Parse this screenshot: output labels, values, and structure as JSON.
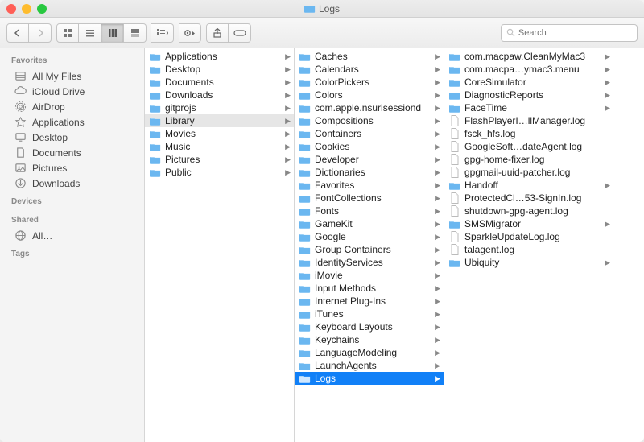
{
  "title": "Logs",
  "search": {
    "placeholder": "Search"
  },
  "sidebar": {
    "sections": [
      {
        "label": "Favorites",
        "items": [
          {
            "label": "All My Files",
            "icon": "all-my-files-icon"
          },
          {
            "label": "iCloud Drive",
            "icon": "icloud-icon"
          },
          {
            "label": "AirDrop",
            "icon": "airdrop-icon"
          },
          {
            "label": "Applications",
            "icon": "applications-icon"
          },
          {
            "label": "Desktop",
            "icon": "desktop-icon"
          },
          {
            "label": "Documents",
            "icon": "documents-icon"
          },
          {
            "label": "Pictures",
            "icon": "pictures-icon"
          },
          {
            "label": "Downloads",
            "icon": "downloads-icon"
          }
        ]
      },
      {
        "label": "Devices",
        "items": []
      },
      {
        "label": "Shared",
        "items": [
          {
            "label": "All…",
            "icon": "globe-icon"
          }
        ]
      },
      {
        "label": "Tags",
        "items": []
      }
    ]
  },
  "columns": [
    {
      "items": [
        {
          "label": "Applications",
          "type": "folder",
          "hasChildren": true
        },
        {
          "label": "Desktop",
          "type": "folder",
          "hasChildren": true
        },
        {
          "label": "Documents",
          "type": "folder",
          "hasChildren": true
        },
        {
          "label": "Downloads",
          "type": "folder",
          "hasChildren": true
        },
        {
          "label": "gitprojs",
          "type": "folder",
          "hasChildren": true
        },
        {
          "label": "Library",
          "type": "folder",
          "hasChildren": true,
          "selected": "gray"
        },
        {
          "label": "Movies",
          "type": "folder",
          "hasChildren": true
        },
        {
          "label": "Music",
          "type": "folder",
          "hasChildren": true
        },
        {
          "label": "Pictures",
          "type": "folder",
          "hasChildren": true
        },
        {
          "label": "Public",
          "type": "folder",
          "hasChildren": true
        }
      ]
    },
    {
      "items": [
        {
          "label": "Caches",
          "type": "folder",
          "hasChildren": true
        },
        {
          "label": "Calendars",
          "type": "folder",
          "hasChildren": true
        },
        {
          "label": "ColorPickers",
          "type": "folder",
          "hasChildren": true
        },
        {
          "label": "Colors",
          "type": "folder",
          "hasChildren": true
        },
        {
          "label": "com.apple.nsurlsessiond",
          "type": "folder",
          "hasChildren": true
        },
        {
          "label": "Compositions",
          "type": "folder",
          "hasChildren": true
        },
        {
          "label": "Containers",
          "type": "folder",
          "hasChildren": true
        },
        {
          "label": "Cookies",
          "type": "folder",
          "hasChildren": true
        },
        {
          "label": "Developer",
          "type": "folder",
          "hasChildren": true
        },
        {
          "label": "Dictionaries",
          "type": "folder",
          "hasChildren": true
        },
        {
          "label": "Favorites",
          "type": "folder",
          "hasChildren": true
        },
        {
          "label": "FontCollections",
          "type": "folder",
          "hasChildren": true
        },
        {
          "label": "Fonts",
          "type": "folder",
          "hasChildren": true
        },
        {
          "label": "GameKit",
          "type": "folder",
          "hasChildren": true
        },
        {
          "label": "Google",
          "type": "folder",
          "hasChildren": true
        },
        {
          "label": "Group Containers",
          "type": "folder",
          "hasChildren": true
        },
        {
          "label": "IdentityServices",
          "type": "folder",
          "hasChildren": true
        },
        {
          "label": "iMovie",
          "type": "folder",
          "hasChildren": true
        },
        {
          "label": "Input Methods",
          "type": "folder",
          "hasChildren": true
        },
        {
          "label": "Internet Plug-Ins",
          "type": "folder",
          "hasChildren": true
        },
        {
          "label": "iTunes",
          "type": "folder",
          "hasChildren": true
        },
        {
          "label": "Keyboard Layouts",
          "type": "folder",
          "hasChildren": true
        },
        {
          "label": "Keychains",
          "type": "folder",
          "hasChildren": true
        },
        {
          "label": "LanguageModeling",
          "type": "folder",
          "hasChildren": true
        },
        {
          "label": "LaunchAgents",
          "type": "folder",
          "hasChildren": true
        },
        {
          "label": "Logs",
          "type": "folder",
          "hasChildren": true,
          "selected": "blue"
        }
      ]
    },
    {
      "items": [
        {
          "label": "com.macpaw.CleanMyMac3",
          "type": "folder",
          "hasChildren": true
        },
        {
          "label": "com.macpa…ymac3.menu",
          "type": "folder",
          "hasChildren": true
        },
        {
          "label": "CoreSimulator",
          "type": "folder",
          "hasChildren": true
        },
        {
          "label": "DiagnosticReports",
          "type": "folder",
          "hasChildren": true
        },
        {
          "label": "FaceTime",
          "type": "folder",
          "hasChildren": true
        },
        {
          "label": "FlashPlayerI…llManager.log",
          "type": "file"
        },
        {
          "label": "fsck_hfs.log",
          "type": "file"
        },
        {
          "label": "GoogleSoft…dateAgent.log",
          "type": "file"
        },
        {
          "label": "gpg-home-fixer.log",
          "type": "file"
        },
        {
          "label": "gpgmail-uuid-patcher.log",
          "type": "file"
        },
        {
          "label": "Handoff",
          "type": "folder",
          "hasChildren": true
        },
        {
          "label": "ProtectedCl…53-SignIn.log",
          "type": "file"
        },
        {
          "label": "shutdown-gpg-agent.log",
          "type": "file"
        },
        {
          "label": "SMSMigrator",
          "type": "folder",
          "hasChildren": true
        },
        {
          "label": "SparkleUpdateLog.log",
          "type": "file"
        },
        {
          "label": "talagent.log",
          "type": "file"
        },
        {
          "label": "Ubiquity",
          "type": "folder",
          "hasChildren": true
        }
      ]
    }
  ]
}
